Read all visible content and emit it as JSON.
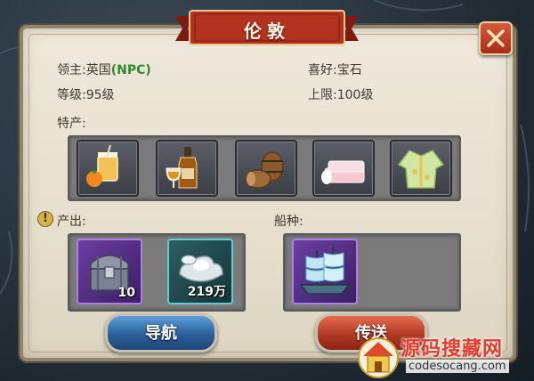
{
  "title": "伦敦",
  "info": {
    "lord_label": "领主:英国",
    "lord_tag": "(NPC)",
    "preference": "喜好:宝石",
    "level": "等级:95级",
    "cap": "上限:100级"
  },
  "specialties": {
    "label": "特产:",
    "items": [
      {
        "icon": "juice-orange-icon"
      },
      {
        "icon": "wine-bottle-icon"
      },
      {
        "icon": "barrels-icon"
      },
      {
        "icon": "cloth-icon"
      },
      {
        "icon": "silk-robe-icon"
      }
    ]
  },
  "output": {
    "label": "产出:",
    "items": [
      {
        "icon": "treasure-chest-icon",
        "count": "10",
        "rarity": "purple"
      },
      {
        "icon": "silver-ingot-icon",
        "count": "219万",
        "rarity": "teal"
      }
    ]
  },
  "ship_type": {
    "label": "船种:",
    "items": [
      {
        "icon": "sailing-ship-icon",
        "rarity": "purple"
      }
    ]
  },
  "buttons": {
    "navigate": "导航",
    "teleport": "传送"
  },
  "watermark": {
    "title": "源码搜藏网",
    "url": "codesocang.com"
  },
  "colors": {
    "npc_green": "#2f8a2a",
    "ribbon_red": "#a8291e",
    "nav_blue": "#2b5f99",
    "teleport_red": "#b23a25",
    "rare_purple": "#b07de6",
    "rare_teal": "#5fd0cf"
  }
}
